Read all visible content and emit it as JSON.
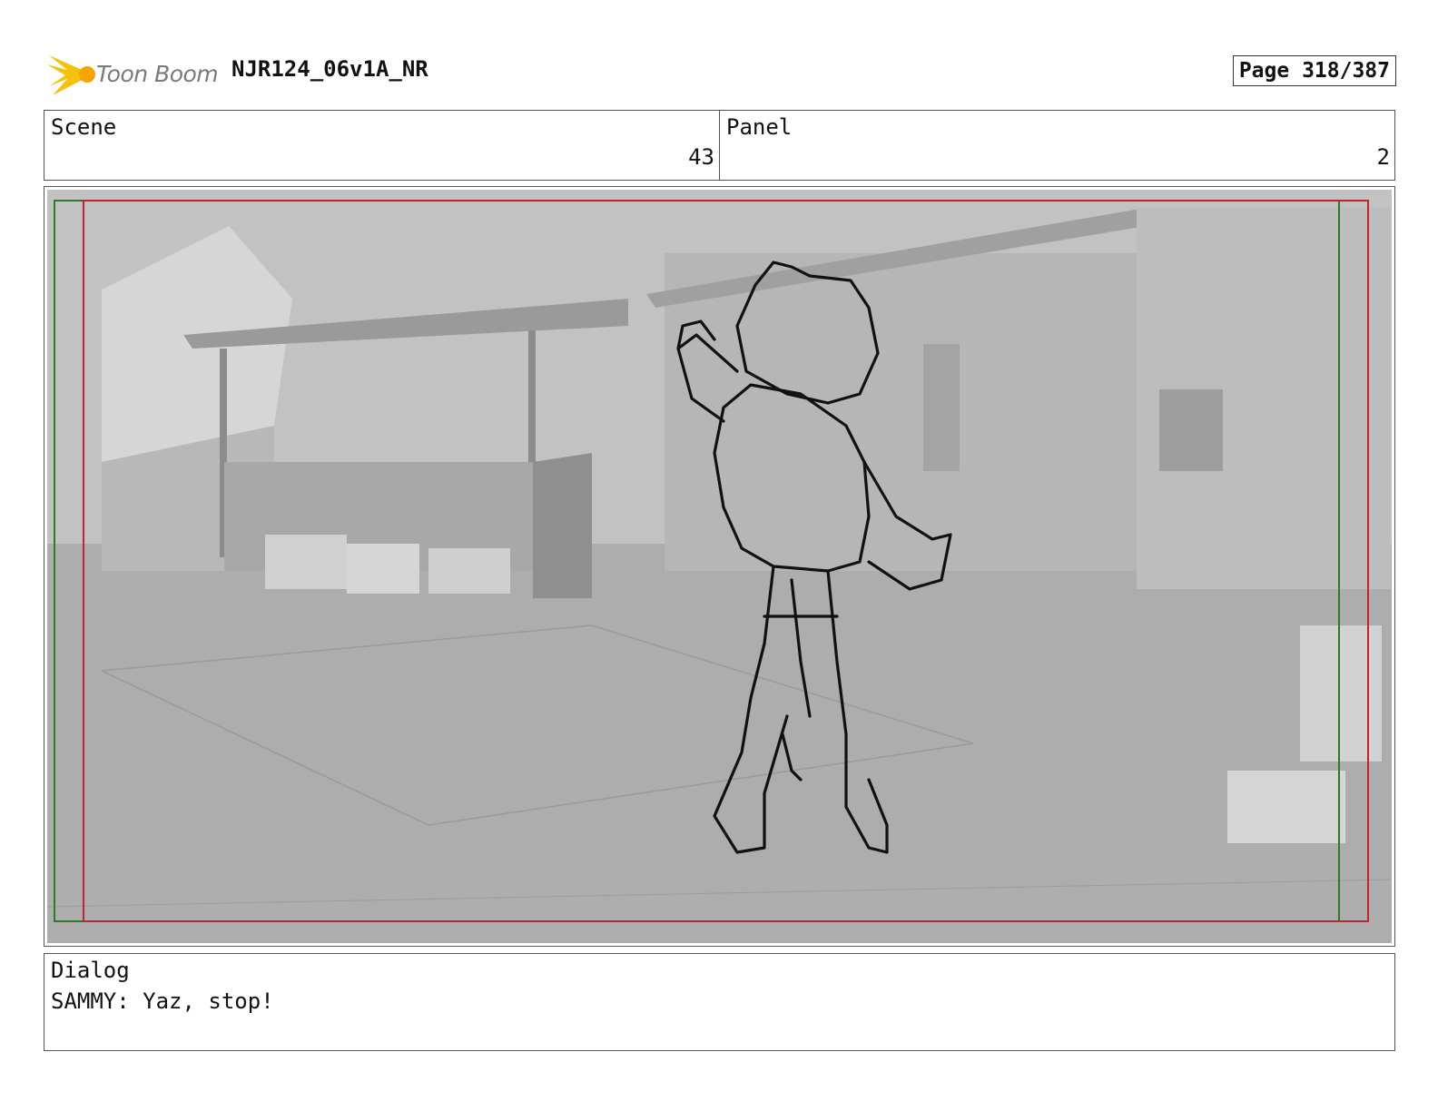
{
  "header": {
    "brand": "Toon Boom",
    "doc_title": "NJR124_06v1A_NR",
    "page": "Page 318/387"
  },
  "scene": {
    "label": "Scene",
    "value": "43"
  },
  "panel": {
    "label": "Panel",
    "value": "2"
  },
  "dialog": {
    "label": "Dialog",
    "text": "SAMMY: Yaz, stop!"
  },
  "colors": {
    "logo_yellow": "#f5c20b",
    "safe_frame_red": "#c0252d",
    "action_frame_green": "#2b7a2b",
    "background_gray": "#b4b4b4"
  }
}
